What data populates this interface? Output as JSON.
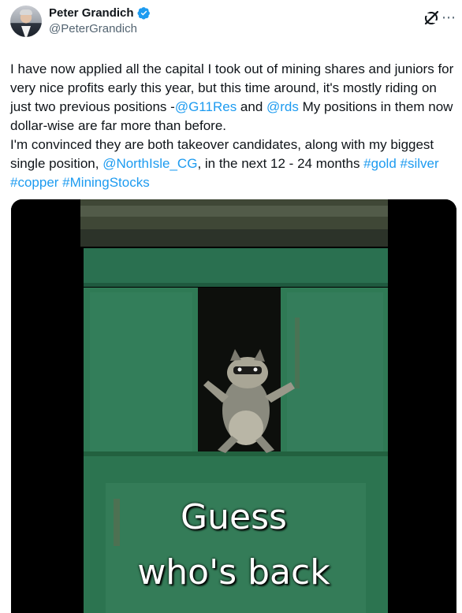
{
  "author": {
    "display_name": "Peter Grandich",
    "handle": "@PeterGrandich",
    "verified": true,
    "avatar": "profile-photo"
  },
  "actions": {
    "grok_icon": "grok-icon",
    "more_icon": "more-horizontal-icon",
    "more_label": "⋯"
  },
  "tweet": {
    "p1_a": "I have now applied all the capital I took out of mining shares and juniors for very nice profits early this year, but this time around, it's mostly riding on just two previous positions -",
    "p1_link1": "@G11Res",
    "p1_b": " and ",
    "p1_link2": "@rds",
    "p1_c": " My positions in them now dollar-wise are far more than before.",
    "p2_a": "I'm convinced they are both takeover candidates, along with my biggest single position, ",
    "p2_link1": "@NorthIsle_CG",
    "p2_b": ", in the next 12 - 24 months ",
    "tag_gold": "#gold",
    "tag_silver": "#silver",
    "tag_copper": "#copper",
    "tag_mining": "#MiningStocks"
  },
  "media": {
    "type": "gif",
    "caption_line1": "Guess",
    "caption_line2": "who's back"
  },
  "colors": {
    "link": "#1d9bf0",
    "verified": "#1d9bf0",
    "dumpster": "#2f7a55"
  }
}
